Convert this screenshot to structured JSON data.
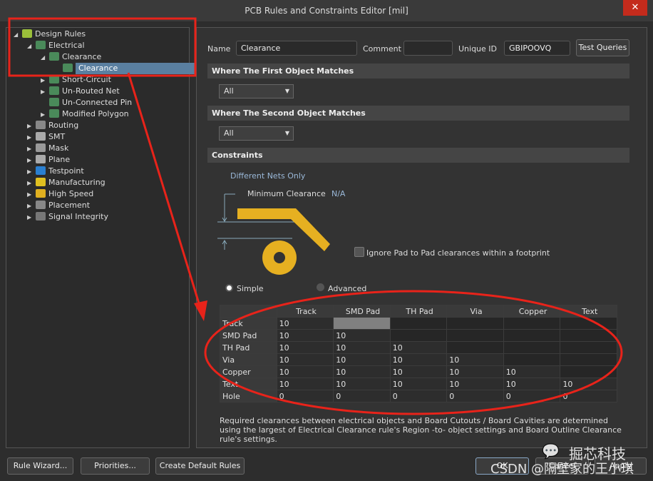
{
  "window": {
    "title": "PCB Rules and Constraints Editor [mil]",
    "close": "✕"
  },
  "tree": [
    {
      "label": "Design Rules",
      "level": 0,
      "arrow": "◢",
      "color": "#9bbf3a"
    },
    {
      "label": "Electrical",
      "level": 1,
      "arrow": "◢",
      "color": "#4a8a5a"
    },
    {
      "label": "Clearance",
      "level": 2,
      "arrow": "◢",
      "color": "#4a8a5a"
    },
    {
      "label": "Clearance",
      "level": 3,
      "arrow": "",
      "color": "#4a8a5a",
      "selected": true
    },
    {
      "label": "Short-Circuit",
      "level": 2,
      "arrow": "▶",
      "color": "#4a8a5a"
    },
    {
      "label": "Un-Routed Net",
      "level": 2,
      "arrow": "▶",
      "color": "#4a8a5a"
    },
    {
      "label": "Un-Connected Pin",
      "level": 2,
      "arrow": "",
      "color": "#4a8a5a"
    },
    {
      "label": "Modified Polygon",
      "level": 2,
      "arrow": "▶",
      "color": "#4a8a5a"
    },
    {
      "label": "Routing",
      "level": 1,
      "arrow": "▶",
      "color": "#888"
    },
    {
      "label": "SMT",
      "level": 1,
      "arrow": "▶",
      "color": "#aaa"
    },
    {
      "label": "Mask",
      "level": 1,
      "arrow": "▶",
      "color": "#999"
    },
    {
      "label": "Plane",
      "level": 1,
      "arrow": "▶",
      "color": "#aaa"
    },
    {
      "label": "Testpoint",
      "level": 1,
      "arrow": "▶",
      "color": "#2a7fd0"
    },
    {
      "label": "Manufacturing",
      "level": 1,
      "arrow": "▶",
      "color": "#e0c020"
    },
    {
      "label": "High Speed",
      "level": 1,
      "arrow": "▶",
      "color": "#e0b020"
    },
    {
      "label": "Placement",
      "level": 1,
      "arrow": "▶",
      "color": "#888"
    },
    {
      "label": "Signal Integrity",
      "level": 1,
      "arrow": "▶",
      "color": "#777"
    }
  ],
  "form": {
    "name_label": "Name",
    "name": "Clearance",
    "comment_label": "Comment",
    "comment": "",
    "uid_label": "Unique ID",
    "uid": "GBIPOOVQ",
    "test_queries": "Test Queries"
  },
  "first": {
    "title": "Where The First Object Matches",
    "value": "All"
  },
  "second": {
    "title": "Where The Second Object Matches",
    "value": "All"
  },
  "constraints": {
    "title": "Constraints",
    "different_nets": "Different Nets Only",
    "min_clearance": "Minimum Clearance",
    "min_value": "N/A",
    "ignore_pad": "Ignore Pad to Pad clearances within a footprint",
    "simple": "Simple",
    "advanced": "Advanced",
    "mode": "Simple",
    "pad_color": "#e6b021"
  },
  "table": {
    "columns": [
      "Track",
      "SMD Pad",
      "TH Pad",
      "Via",
      "Copper",
      "Text"
    ],
    "rows": [
      {
        "label": "Track",
        "values": [
          "10",
          "",
          "",
          "",
          "",
          ""
        ]
      },
      {
        "label": "SMD Pad",
        "values": [
          "10",
          "10",
          "",
          "",
          "",
          ""
        ]
      },
      {
        "label": "TH Pad",
        "values": [
          "10",
          "10",
          "10",
          "",
          "",
          ""
        ]
      },
      {
        "label": "Via",
        "values": [
          "10",
          "10",
          "10",
          "10",
          "",
          ""
        ]
      },
      {
        "label": "Copper",
        "values": [
          "10",
          "10",
          "10",
          "10",
          "10",
          ""
        ]
      },
      {
        "label": "Text",
        "values": [
          "10",
          "10",
          "10",
          "10",
          "10",
          "10"
        ]
      },
      {
        "label": "Hole",
        "values": [
          "0",
          "0",
          "0",
          "0",
          "0",
          "0"
        ]
      }
    ]
  },
  "note": "Required clearances between electrical objects and Board Cutouts / Board Cavities are determined using the largest of Electrical Clearance rule's Region -to- object settings and Board Outline Clearance rule's settings.",
  "footer": {
    "rule_wizard": "Rule Wizard...",
    "priorities": "Priorities...",
    "create_default": "Create Default Rules",
    "ok": "OK",
    "cancel": "Cancel",
    "apply": "Apply"
  },
  "watermark": {
    "line1": "掘芯科技",
    "line2": "CSDN @隔壁家的王小琪"
  },
  "annotation_color": "#e8231a"
}
